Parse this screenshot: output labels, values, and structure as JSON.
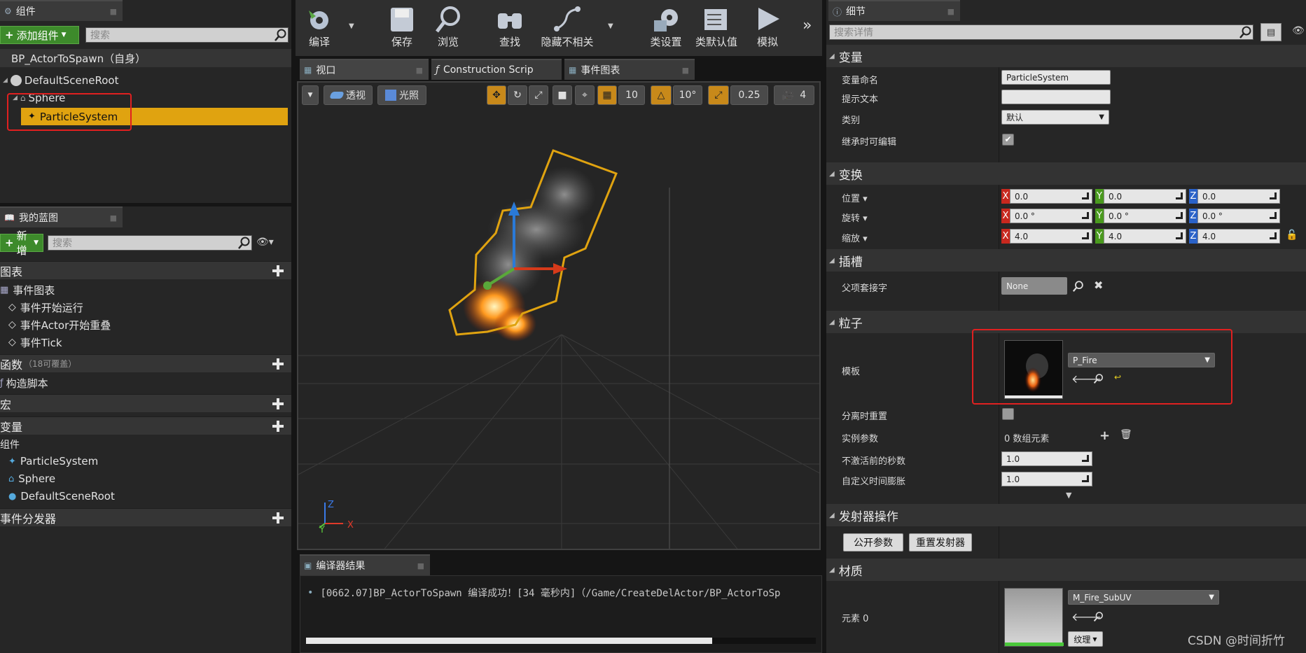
{
  "left": {
    "components_tab": "组件",
    "add_component": "添加组件",
    "search_placeholder": "搜索",
    "self_row": "BP_ActorToSpawn（自身）",
    "tree": [
      "DefaultSceneRoot",
      "Sphere",
      "ParticleSystem"
    ],
    "my_blueprint_tab": "我的蓝图",
    "new_button": "新增",
    "search_placeholder2": "搜索",
    "graphs_header": "图表",
    "event_graph": "事件图表",
    "events": [
      "事件开始运行",
      "事件Actor开始重叠",
      "事件Tick"
    ],
    "functions_header": "函数",
    "functions_note": "（18可覆盖）",
    "construction_script": "构造脚本",
    "macros_header": "宏",
    "variables_header": "变量",
    "components_group": "组件",
    "variables": [
      "ParticleSystem",
      "Sphere",
      "DefaultSceneRoot"
    ],
    "dispatchers_header": "事件分发器"
  },
  "toolbar": {
    "buttons": [
      "编译",
      "保存",
      "浏览",
      "查找",
      "隐藏不相关",
      "类设置",
      "类默认值",
      "模拟"
    ]
  },
  "center": {
    "tabs": [
      "视口",
      "Construction Scrip",
      "事件图表"
    ],
    "perspective": "透视",
    "lighting": "光照",
    "grid_snap": "10",
    "rot_snap": "10°",
    "scale_snap": "0.25",
    "cam_speed": "4",
    "axis_x": "X",
    "axis_y": "Y",
    "axis_z": "Z",
    "compiler_tab": "编译器结果",
    "compiler_log": "[0662.07]BP_ActorToSpawn 编译成功！[34 毫秒内]（/Game/CreateDelActor/BP_ActorToSp"
  },
  "details": {
    "tab": "细节",
    "search_placeholder": "搜索详情",
    "sections": {
      "variable": "变量",
      "transform": "变换",
      "sockets": "插槽",
      "particles": "粒子",
      "emitter_ops": "发射器操作",
      "materials": "材质"
    },
    "variable_name_label": "变量命名",
    "variable_name": "ParticleSystem",
    "tooltip_label": "提示文本",
    "category_label": "类别",
    "category_value": "默认",
    "editable_label": "继承时可编辑",
    "location_label": "位置",
    "rotation_label": "旋转",
    "scale_label": "缩放",
    "location": [
      "0.0",
      "0.0",
      "0.0"
    ],
    "rotation": [
      "0.0 °",
      "0.0 °",
      "0.0 °"
    ],
    "scale": [
      "4.0",
      "4.0",
      "4.0"
    ],
    "parent_socket_label": "父项套接字",
    "parent_socket_value": "None",
    "template_label": "模板",
    "template_value": "P_Fire",
    "reset_on_detach_label": "分离时重置",
    "instance_params_label": "实例参数",
    "instance_params_value": "0 数组元素",
    "warmup_label": "不激活前的秒数",
    "warmup_value": "1.0",
    "time_dilation_label": "自定义时间膨胀",
    "time_dilation_value": "1.0",
    "expose_params_btn": "公开参数",
    "reset_emitters_btn": "重置发射器",
    "element0_label": "元素 0",
    "material_value": "M_Fire_SubUV",
    "texture_btn": "纹理"
  },
  "watermark": "CSDN @时间折竹",
  "colors": {
    "accent_orange": "#e0a310",
    "green": "#3d8a2b",
    "highlight_red": "#e02020"
  }
}
